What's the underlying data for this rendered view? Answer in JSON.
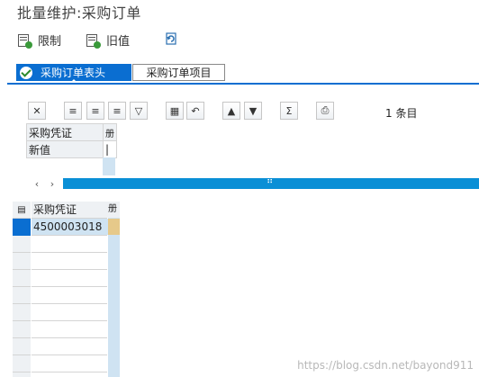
{
  "title": "批量维护:采购订单",
  "toolbar": {
    "restrict_label": "限制",
    "old_value_label": "旧值",
    "refresh_icon": "refresh-icon"
  },
  "tabs": [
    {
      "label": "采购订单表头",
      "active": true
    },
    {
      "label": "采购订单项目",
      "active": false
    }
  ],
  "alv_toolbar": {
    "count_text": "1 条目"
  },
  "top_grid": {
    "col1_header": "采购凭证",
    "col2_header": "册",
    "row_label": "新值",
    "row_value": ""
  },
  "bottom_grid": {
    "col1_header": "采购凭证",
    "col2_header": "册",
    "rows": [
      {
        "doc": "4500003018"
      }
    ]
  },
  "scroll_handle": "⠿",
  "watermark": "https://blog.csdn.net/bayond911",
  "colors": {
    "accent": "#0a6ed1",
    "thumb": "#0a8fd6"
  }
}
